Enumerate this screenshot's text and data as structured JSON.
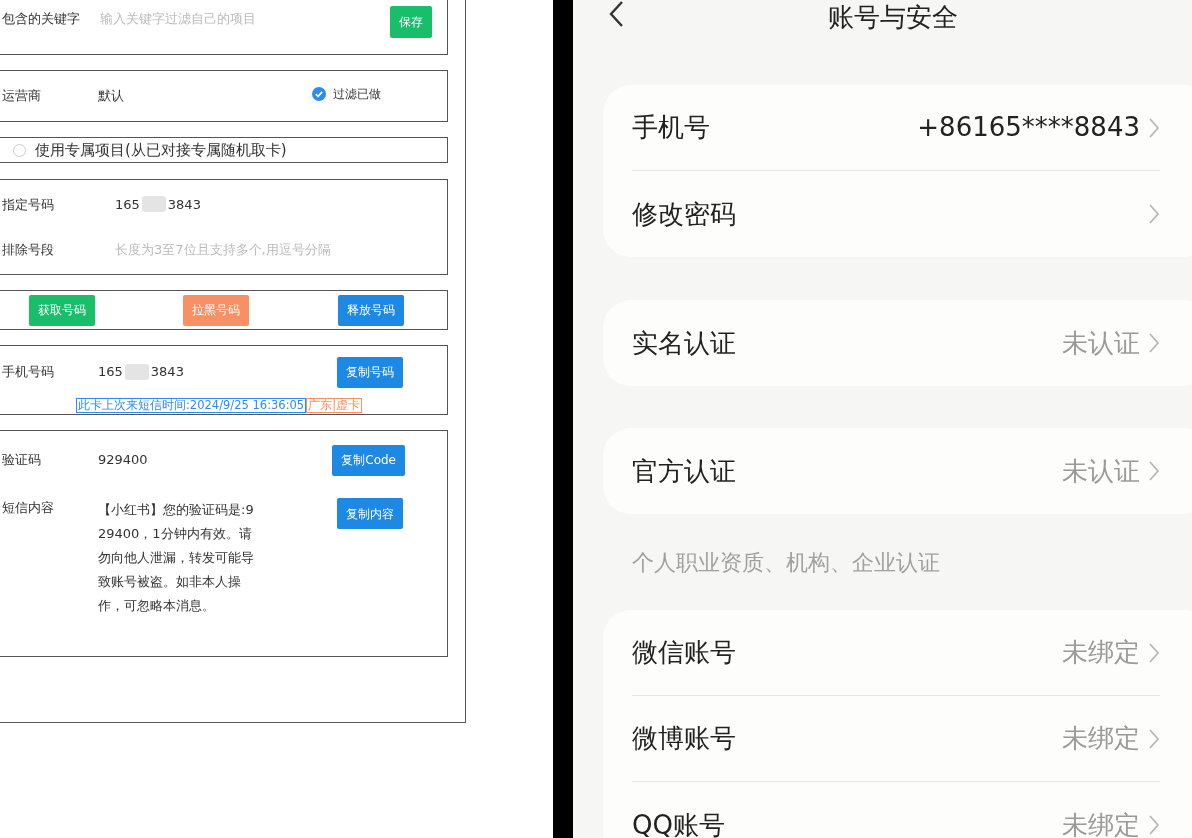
{
  "keyword_filter": {
    "label": "包含的关键字",
    "placeholder": "输入关键字过滤自己的项目",
    "save_button": "保存"
  },
  "carrier": {
    "label": "运营商",
    "value": "默认",
    "filter_done": {
      "label": "过滤已做",
      "checked": true
    }
  },
  "exclusive": {
    "label": "使用专属项目(从已对接专属随机取卡)",
    "selected": false
  },
  "number_options": {
    "specified": {
      "label": "指定号码",
      "value_start": "165",
      "value_end": "3843"
    },
    "exclude": {
      "label": "排除号段",
      "placeholder": "长度为3至7位且支持多个,用逗号分隔"
    }
  },
  "actions": [
    {
      "label": "获取号码",
      "color": "#19be6b"
    },
    {
      "label": "拉黑号码",
      "color": "#f79065"
    },
    {
      "label": "释放号码",
      "color": "#1e88e5"
    }
  ],
  "phone": {
    "label": "手机号码",
    "value_start": "165",
    "value_end": "3843",
    "copy_button": "复制号码",
    "last_sms": "此卡上次来短信时间:2024/9/25 16:36:05",
    "tag": "广东|虚卡"
  },
  "sms": {
    "code_label": "验证码",
    "code": "929400",
    "copy_code": "复制Code",
    "content_label": "短信内容",
    "content": "【小红书】您的验证码是:929400，1分钟内有效。请勿向他人泄漏，转发可能导致账号被盗。如非本人操作，可忽略本消息。",
    "copy_content": "复制内容"
  },
  "mobile": {
    "title": "账号与安全",
    "groups": [
      {
        "rows": [
          {
            "label": "手机号",
            "value": "+86165****8843",
            "kind": "info"
          },
          {
            "label": "修改密码",
            "kind": "link"
          }
        ]
      },
      {
        "rows": [
          {
            "label": "实名认证",
            "value": "未认证",
            "kind": "status"
          }
        ]
      },
      {
        "rows": [
          {
            "label": "官方认证",
            "value": "未认证",
            "kind": "status"
          }
        ],
        "note": "个人职业资质、机构、企业认证"
      },
      {
        "rows": [
          {
            "label": "微信账号",
            "value": "未绑定",
            "kind": "status"
          },
          {
            "label": "微博账号",
            "value": "未绑定",
            "kind": "status"
          },
          {
            "label": "QQ账号",
            "value": "未绑定",
            "kind": "status"
          }
        ]
      }
    ]
  }
}
